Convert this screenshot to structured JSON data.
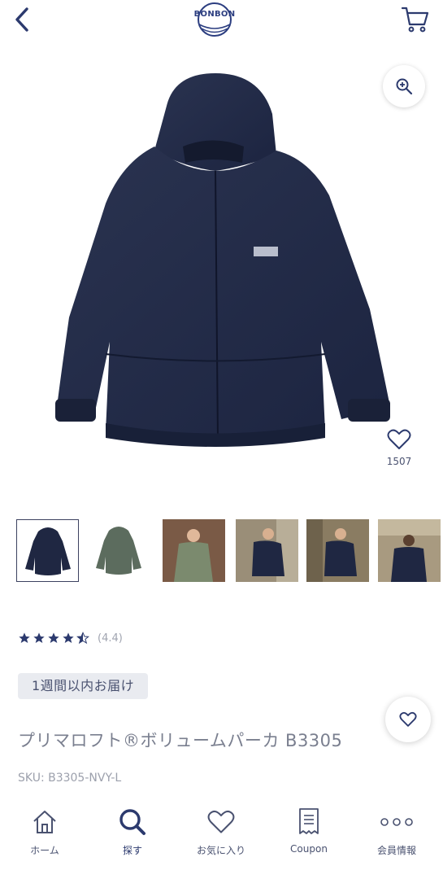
{
  "header": {
    "logo_text": "BONBON",
    "back_icon": "chevron-left-icon",
    "cart_icon": "cart-icon"
  },
  "hero": {
    "zoom_icon": "zoom-in-icon",
    "like_icon": "heart-icon",
    "like_count": "1507"
  },
  "thumbnails": [
    {
      "name": "navy-parka",
      "selected": true
    },
    {
      "name": "olive-parka",
      "selected": false
    },
    {
      "name": "model-front",
      "selected": false
    },
    {
      "name": "model-side-1",
      "selected": false
    },
    {
      "name": "model-side-2",
      "selected": false
    },
    {
      "name": "model-back",
      "selected": false
    }
  ],
  "rating": {
    "value": 4.4,
    "label": "(4.4)"
  },
  "delivery_badge": "1週間以内お届け",
  "product": {
    "title": "プリマロフト®ボリュームパーカ B3305",
    "sku": "SKU: B3305-NVY-L"
  },
  "tabbar": {
    "items": [
      {
        "label": "ホーム",
        "icon": "home-icon"
      },
      {
        "label": "探す",
        "icon": "search-icon"
      },
      {
        "label": "お気に入り",
        "icon": "heart-icon"
      },
      {
        "label": "Coupon",
        "icon": "coupon-icon"
      },
      {
        "label": "会員情報",
        "icon": "more-icon"
      }
    ]
  },
  "colors": {
    "navy": "#2c3a6e",
    "text": "#4a5270",
    "muted": "#9ca0ac",
    "star": "#2c3a6e"
  }
}
